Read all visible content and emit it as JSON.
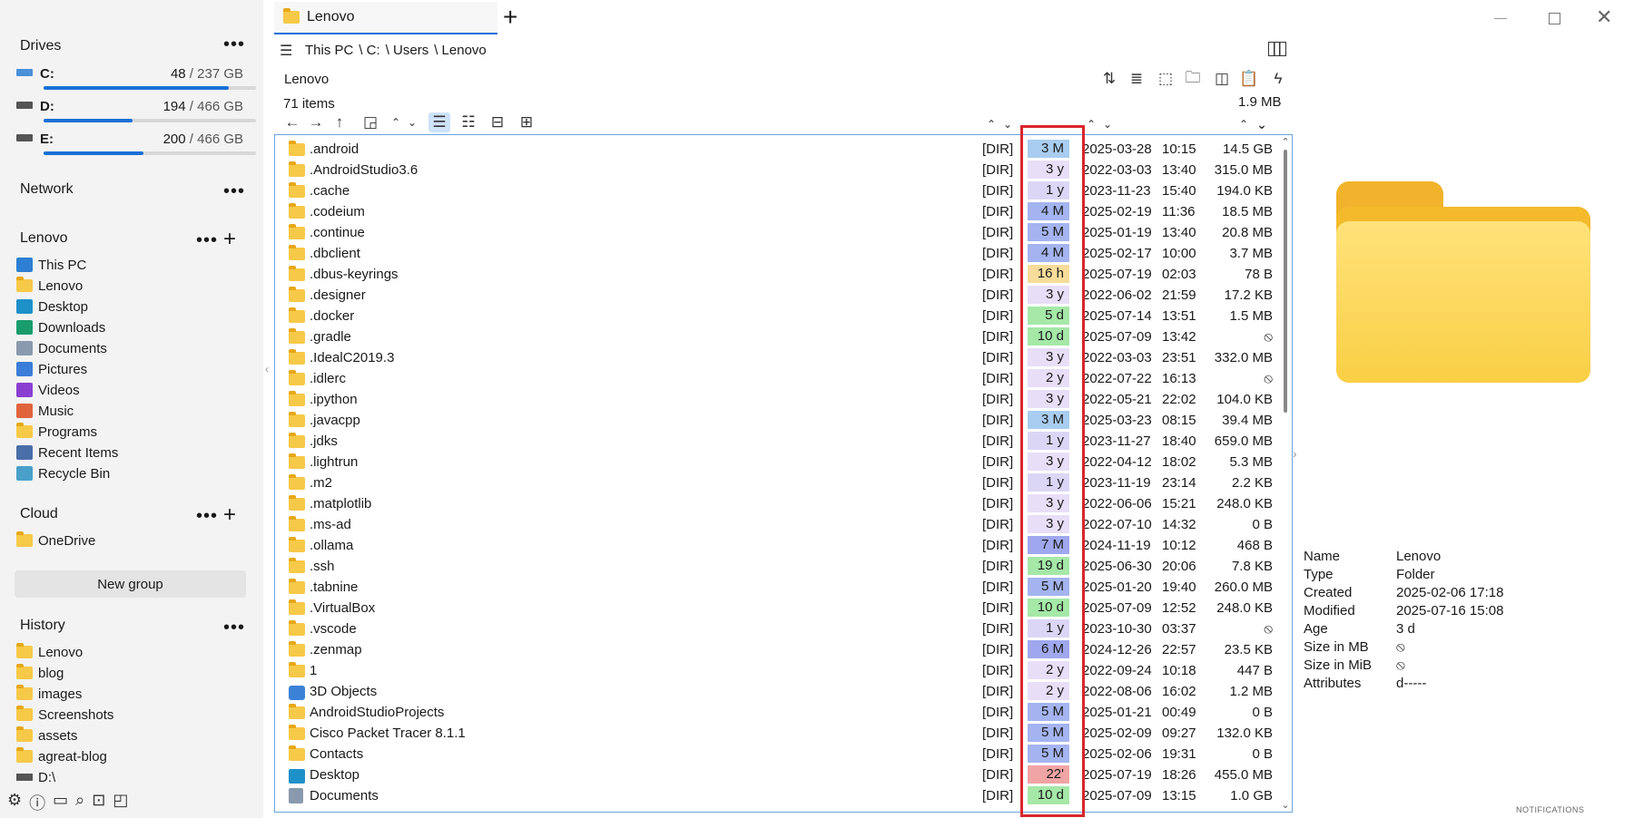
{
  "window": {
    "tab_number": "1",
    "tab_title": "Lenovo"
  },
  "drives": {
    "title": "Drives",
    "items": [
      {
        "letter": "C:",
        "used": "48",
        "total": "/ 237 GB",
        "fill": 0.87
      },
      {
        "letter": "D:",
        "used": "194",
        "total": "/ 466 GB",
        "fill": 0.42
      },
      {
        "letter": "E:",
        "used": "200",
        "total": "/ 466 GB",
        "fill": 0.47
      }
    ]
  },
  "network": {
    "title": "Network"
  },
  "places": {
    "title": "Lenovo",
    "items": [
      "This PC",
      "Lenovo",
      "Desktop",
      "Downloads",
      "Documents",
      "Pictures",
      "Videos",
      "Music",
      "Programs",
      "Recent Items",
      "Recycle Bin"
    ]
  },
  "cloud": {
    "title": "Cloud",
    "items": [
      "OneDrive"
    ]
  },
  "new_group_label": "New group",
  "history": {
    "title": "History",
    "items": [
      "Lenovo",
      "blog",
      "images",
      "Screenshots",
      "assets",
      "agreat-blog",
      "D:\\"
    ]
  },
  "breadcrumb": {
    "this_pc": "This PC",
    "c": "\\ C:",
    "users": "\\ Users",
    "lenovo": "\\ Lenovo"
  },
  "location_title": "Lenovo",
  "item_count": "71 items",
  "total_size": "1.9 MB",
  "dir_tag": "[DIR]",
  "files": [
    {
      "name": ".android",
      "age": "3 M",
      "cls": "c-M",
      "date": "2025-03-28",
      "time": "10:15",
      "size": "14.5 GB"
    },
    {
      "name": ".AndroidStudio3.6",
      "age": "3 y",
      "cls": "c-y",
      "date": "2022-03-03",
      "time": "13:40",
      "size": "315.0 MB"
    },
    {
      "name": ".cache",
      "age": "1 y",
      "cls": "c-1y",
      "date": "2023-11-23",
      "time": "15:40",
      "size": "194.0 KB"
    },
    {
      "name": ".codeium",
      "age": "4 M",
      "cls": "c-M2",
      "date": "2025-02-19",
      "time": "11:36",
      "size": "18.5 MB"
    },
    {
      "name": ".continue",
      "age": "5 M",
      "cls": "c-M2",
      "date": "2025-01-19",
      "time": "13:40",
      "size": "20.8 MB"
    },
    {
      "name": ".dbclient",
      "age": "4 M",
      "cls": "c-M2",
      "date": "2025-02-17",
      "time": "10:00",
      "size": "3.7 MB"
    },
    {
      "name": ".dbus-keyrings",
      "age": "16 h",
      "cls": "c-h",
      "date": "2025-07-19",
      "time": "02:03",
      "size": "78 B"
    },
    {
      "name": ".designer",
      "age": "3 y",
      "cls": "c-y",
      "date": "2022-06-02",
      "time": "21:59",
      "size": "17.2 KB"
    },
    {
      "name": ".docker",
      "age": "5 d",
      "cls": "c-d",
      "date": "2025-07-14",
      "time": "13:51",
      "size": "1.5 MB"
    },
    {
      "name": ".gradle",
      "age": "10 d",
      "cls": "c-d",
      "date": "2025-07-09",
      "time": "13:42",
      "size": "⦸"
    },
    {
      "name": ".IdealC2019.3",
      "age": "3 y",
      "cls": "c-y",
      "date": "2022-03-03",
      "time": "23:51",
      "size": "332.0 MB"
    },
    {
      "name": ".idlerc",
      "age": "2 y",
      "cls": "c-y",
      "date": "2022-07-22",
      "time": "16:13",
      "size": "⦸"
    },
    {
      "name": ".ipython",
      "age": "3 y",
      "cls": "c-y",
      "date": "2022-05-21",
      "time": "22:02",
      "size": "104.0 KB"
    },
    {
      "name": ".javacpp",
      "age": "3 M",
      "cls": "c-M",
      "date": "2025-03-23",
      "time": "08:15",
      "size": "39.4 MB"
    },
    {
      "name": ".jdks",
      "age": "1 y",
      "cls": "c-1y",
      "date": "2023-11-27",
      "time": "18:40",
      "size": "659.0 MB"
    },
    {
      "name": ".lightrun",
      "age": "3 y",
      "cls": "c-y",
      "date": "2022-04-12",
      "time": "18:02",
      "size": "5.3 MB"
    },
    {
      "name": ".m2",
      "age": "1 y",
      "cls": "c-1y",
      "date": "2023-11-19",
      "time": "23:14",
      "size": "2.2 KB"
    },
    {
      "name": ".matplotlib",
      "age": "3 y",
      "cls": "c-y",
      "date": "2022-06-06",
      "time": "15:21",
      "size": "248.0 KB"
    },
    {
      "name": ".ms-ad",
      "age": "3 y",
      "cls": "c-y",
      "date": "2022-07-10",
      "time": "14:32",
      "size": "0 B"
    },
    {
      "name": ".ollama",
      "age": "7 M",
      "cls": "c-M3",
      "date": "2024-11-19",
      "time": "10:12",
      "size": "468 B"
    },
    {
      "name": ".ssh",
      "age": "19 d",
      "cls": "c-d",
      "date": "2025-06-30",
      "time": "20:06",
      "size": "7.8 KB"
    },
    {
      "name": ".tabnine",
      "age": "5 M",
      "cls": "c-M2",
      "date": "2025-01-20",
      "time": "19:40",
      "size": "260.0 MB"
    },
    {
      "name": ".VirtualBox",
      "age": "10 d",
      "cls": "c-d",
      "date": "2025-07-09",
      "time": "12:52",
      "size": "248.0 KB"
    },
    {
      "name": ".vscode",
      "age": "1 y",
      "cls": "c-1y",
      "date": "2023-10-30",
      "time": "03:37",
      "size": "⦸"
    },
    {
      "name": ".zenmap",
      "age": "6 M",
      "cls": "c-M3",
      "date": "2024-12-26",
      "time": "22:57",
      "size": "23.5 KB"
    },
    {
      "name": "1",
      "age": "2 y",
      "cls": "c-y",
      "date": "2022-09-24",
      "time": "10:18",
      "size": "447 B"
    },
    {
      "name": "3D Objects",
      "age": "2 y",
      "cls": "c-y",
      "date": "2022-08-06",
      "time": "16:02",
      "size": "1.2 MB",
      "icon": "cube"
    },
    {
      "name": "AndroidStudioProjects",
      "age": "5 M",
      "cls": "c-M2",
      "date": "2025-01-21",
      "time": "00:49",
      "size": "0 B"
    },
    {
      "name": "Cisco Packet Tracer 8.1.1",
      "age": "5 M",
      "cls": "c-M2",
      "date": "2025-02-09",
      "time": "09:27",
      "size": "132.0 KB"
    },
    {
      "name": "Contacts",
      "age": "5 M",
      "cls": "c-M2",
      "date": "2025-02-06",
      "time": "19:31",
      "size": "0 B"
    },
    {
      "name": "Desktop",
      "age": "22'",
      "cls": "c-red",
      "date": "2025-07-19",
      "time": "18:26",
      "size": "455.0 MB",
      "icon": "desktop"
    },
    {
      "name": "Documents",
      "age": "10 d",
      "cls": "c-d",
      "date": "2025-07-09",
      "time": "13:15",
      "size": "1.0 GB",
      "icon": "doc"
    }
  ],
  "properties": [
    {
      "k": "Name",
      "v": "Lenovo"
    },
    {
      "k": "Type",
      "v": "Folder"
    },
    {
      "k": "Created",
      "v": "2025-02-06  17:18"
    },
    {
      "k": "Modified",
      "v": "2025-07-16  15:08"
    },
    {
      "k": "Age",
      "v": "3 d"
    },
    {
      "k": "Size in MB",
      "v": "⦸"
    },
    {
      "k": "Size in MiB",
      "v": "⦸"
    },
    {
      "k": "Attributes",
      "v": "d-----"
    }
  ],
  "notifications_label": "NOTIFICATIONS",
  "highlight_color": "#d9262b"
}
